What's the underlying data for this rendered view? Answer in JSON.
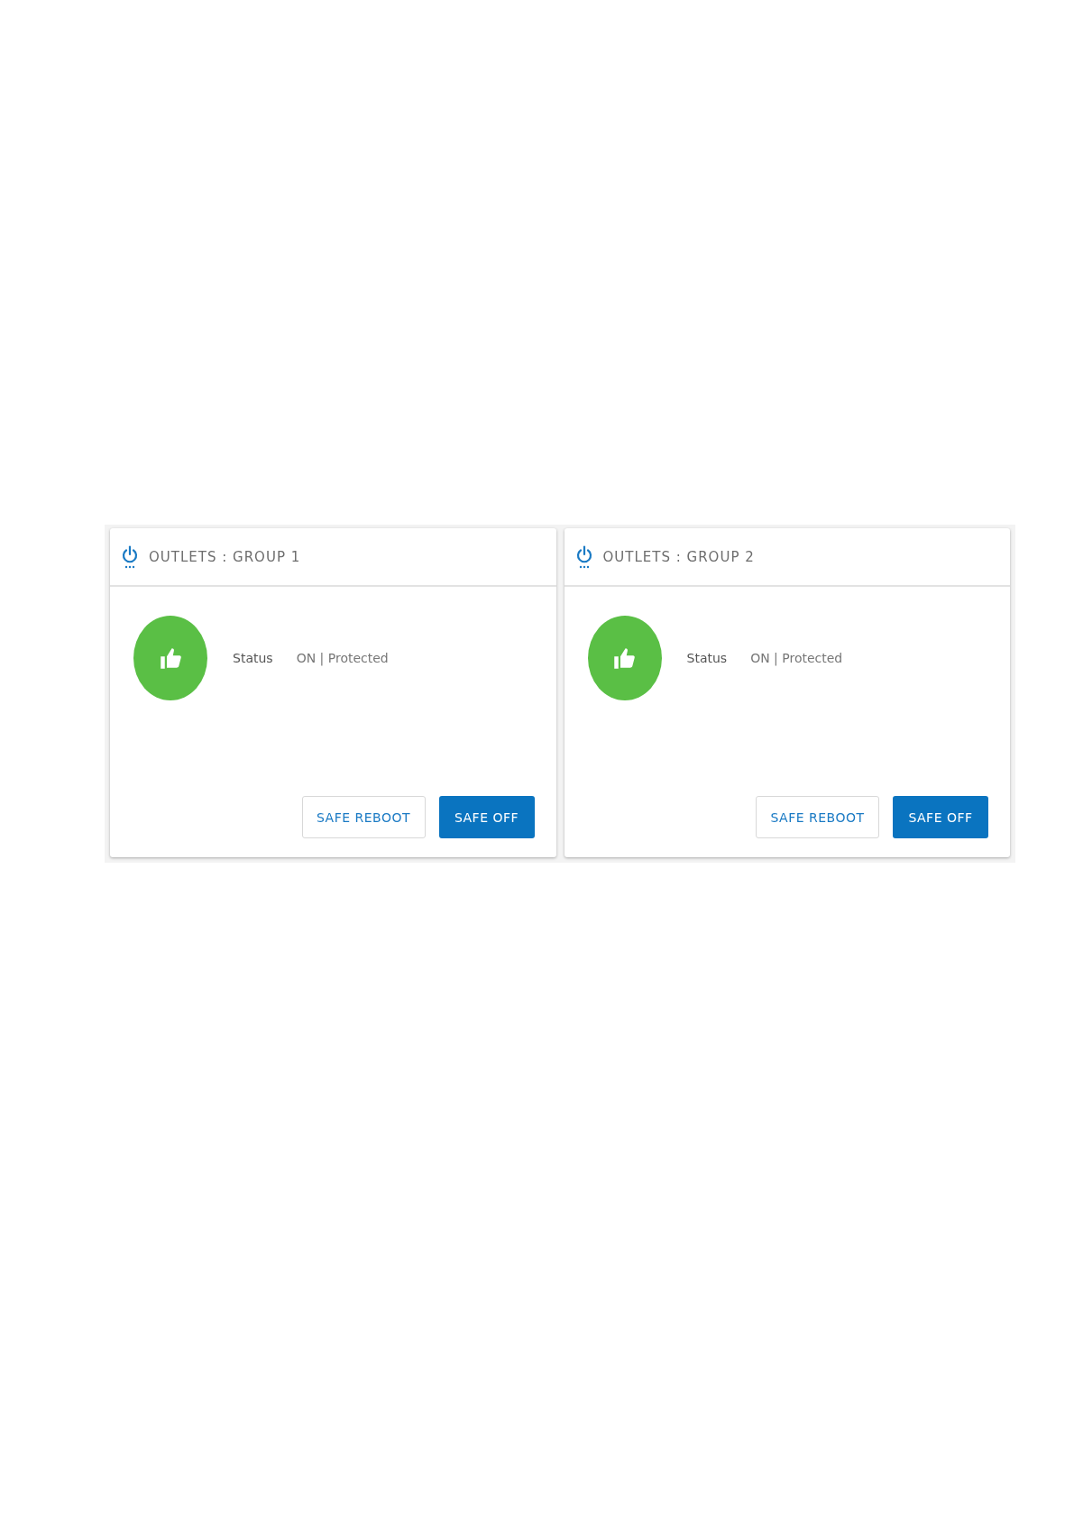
{
  "groups": [
    {
      "title": "OUTLETS : GROUP 1",
      "status_label": "Status",
      "status_value": "ON | Protected",
      "buttons": [
        {
          "label": "SAFE REBOOT",
          "kind": "outlined"
        },
        {
          "label": "SAFE OFF",
          "kind": "filled"
        }
      ]
    },
    {
      "title": "OUTLETS : GROUP 2",
      "status_label": "Status",
      "status_value": "ON | Protected",
      "buttons": [
        {
          "label": "SAFE REBOOT",
          "kind": "outlined"
        },
        {
          "label": "SAFE OFF",
          "kind": "filled"
        }
      ]
    }
  ]
}
